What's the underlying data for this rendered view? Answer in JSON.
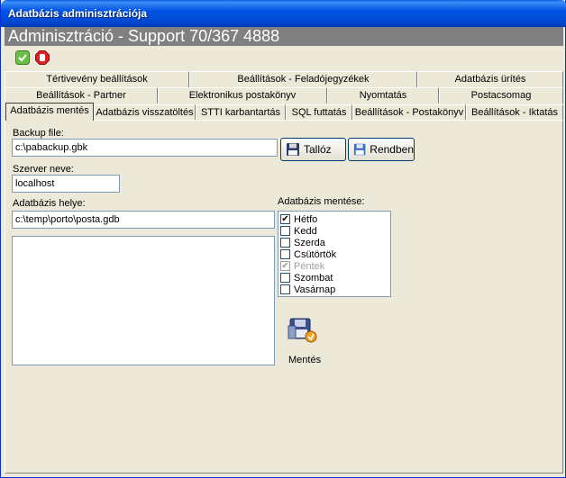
{
  "window": {
    "title": "Adatbázis adminisztrációja"
  },
  "banner": {
    "text": "Adminisztráció - Support 70/367 4888"
  },
  "toolbar": {
    "ok_icon": "green-check-icon",
    "stop_icon": "stop-hand-icon"
  },
  "tabs": {
    "row1": [
      "Tértivevény beállítások",
      "Beállítások - Feladójegyzékek",
      "Adatbázis ürítés"
    ],
    "row2": [
      "Beállítások - Partner",
      "Elektronikus postakönyv",
      "Nyomtatás",
      "Postacsomag"
    ],
    "row3": [
      "Adatbázis mentés",
      "Adatbázis visszatöltés",
      "STTI karbantartás",
      "SQL futtatás",
      "Beállítások - Postakönyv",
      "Beállítások - Iktatás"
    ]
  },
  "form": {
    "backup_label": "Backup file:",
    "backup_value": "c:\\pabackup.gbk",
    "browse_label": "Tallóz",
    "ok_label": "Rendben",
    "server_label": "Szerver neve:",
    "server_value": "localhost",
    "dbpath_label": "Adatbázis helye:",
    "dbpath_value": "c:\\temp\\porto\\posta.gdb",
    "schedule_label": "Adatbázis mentése:",
    "days": [
      {
        "label": "Hétfo",
        "checked": true,
        "disabled": false
      },
      {
        "label": "Kedd",
        "checked": false,
        "disabled": false
      },
      {
        "label": "Szerda",
        "checked": false,
        "disabled": false
      },
      {
        "label": "Csütörtök",
        "checked": false,
        "disabled": false
      },
      {
        "label": "Péntek",
        "checked": true,
        "disabled": true
      },
      {
        "label": "Szombat",
        "checked": false,
        "disabled": false
      },
      {
        "label": "Vasárnap",
        "checked": false,
        "disabled": false
      }
    ],
    "save_label": "Mentés"
  }
}
